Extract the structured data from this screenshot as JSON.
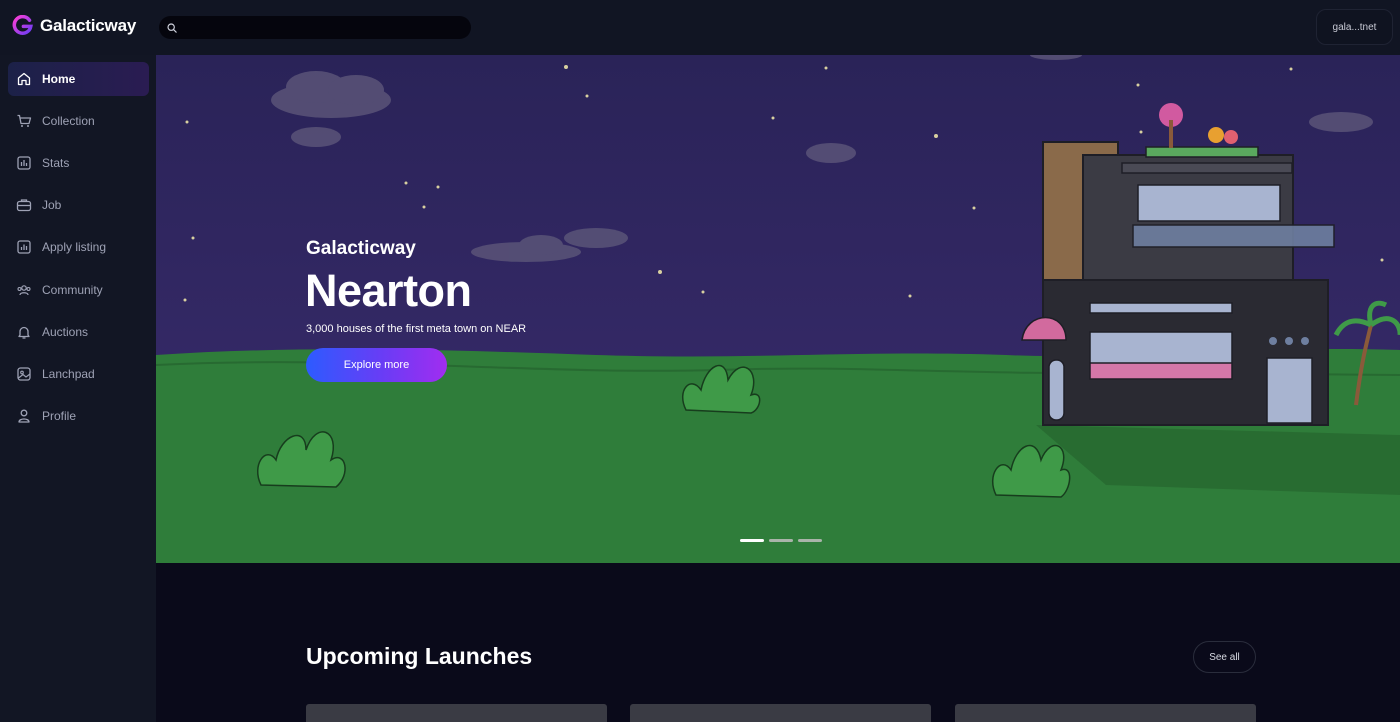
{
  "app": {
    "name": "Galacticway"
  },
  "search": {
    "placeholder": ""
  },
  "wallet": {
    "label": "gala...tnet"
  },
  "sidebar": {
    "items": [
      {
        "label": "Home",
        "icon": "home-icon",
        "active": true
      },
      {
        "label": "Collection",
        "icon": "cart-icon",
        "active": false
      },
      {
        "label": "Stats",
        "icon": "stats-icon",
        "active": false
      },
      {
        "label": "Job",
        "icon": "briefcase-icon",
        "active": false
      },
      {
        "label": "Apply listing",
        "icon": "chart-icon",
        "active": false
      },
      {
        "label": "Community",
        "icon": "community-icon",
        "active": false
      },
      {
        "label": "Auctions",
        "icon": "bell-icon",
        "active": false
      },
      {
        "label": "Lanchpad",
        "icon": "image-icon",
        "active": false
      },
      {
        "label": "Profile",
        "icon": "user-icon",
        "active": false
      }
    ]
  },
  "hero": {
    "brand": "Galacticway",
    "title": "Nearton",
    "subtitle": "3,000 houses of the first meta town on NEAR",
    "cta": "Explore more",
    "slides": 3,
    "active_slide": 0
  },
  "upcoming": {
    "title": "Upcoming Launches",
    "see_all": "See all"
  },
  "colors": {
    "accent_start": "#2d5bff",
    "accent_end": "#a12df0",
    "sky": "#2e2660",
    "grass": "#2f7d3a",
    "background": "#0a0a1a",
    "sidebar": "#121624"
  }
}
